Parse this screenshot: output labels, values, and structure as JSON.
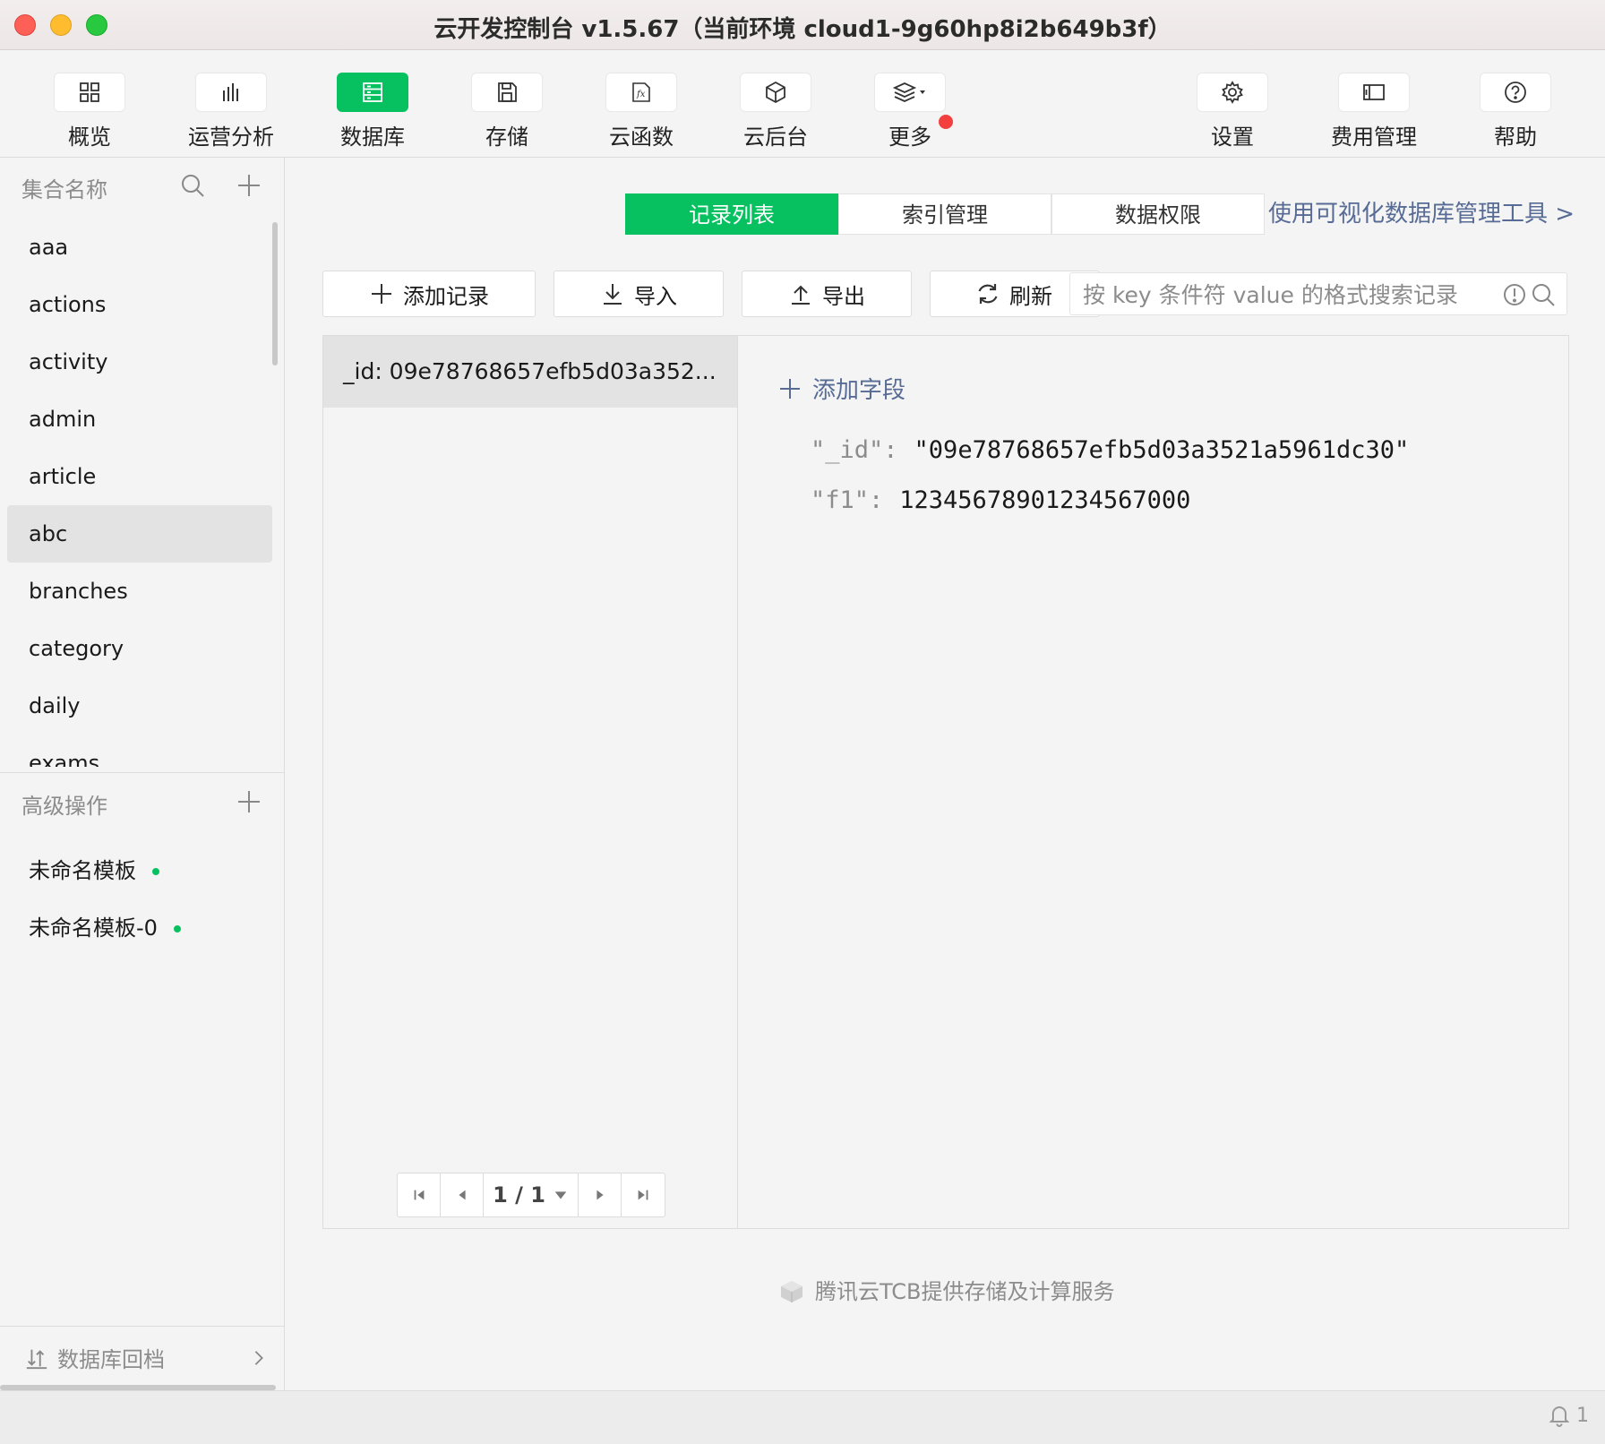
{
  "window": {
    "title": "云开发控制台 v1.5.67（当前环境 cloud1-9g60hp8i2b649b3f）"
  },
  "toolbar": {
    "items": [
      {
        "label": "概览",
        "icon": "grid-icon"
      },
      {
        "label": "运营分析",
        "icon": "bar-chart-icon"
      },
      {
        "label": "数据库",
        "icon": "database-icon"
      },
      {
        "label": "存储",
        "icon": "save-icon"
      },
      {
        "label": "云函数",
        "icon": "function-icon"
      },
      {
        "label": "云后台",
        "icon": "cube-icon"
      },
      {
        "label": "更多",
        "icon": "layers-icon"
      }
    ],
    "right_items": [
      {
        "label": "设置",
        "icon": "gear-icon"
      },
      {
        "label": "费用管理",
        "icon": "wallet-icon"
      },
      {
        "label": "帮助",
        "icon": "help-icon"
      }
    ],
    "active": "数据库"
  },
  "sidebar": {
    "collections_header": "集合名称",
    "collections": [
      "aaa",
      "actions",
      "activity",
      "admin",
      "article",
      "abc",
      "branches",
      "category",
      "daily",
      "exams"
    ],
    "selected": "abc",
    "advanced_header": "高级操作",
    "templates": [
      "未命名模板",
      "未命名模板-0"
    ],
    "backup_label": "数据库回档"
  },
  "tabs": {
    "records": "记录列表",
    "index": "索引管理",
    "permissions": "数据权限"
  },
  "vis_link": "使用可视化数据库管理工具 >",
  "actions": {
    "add_record": "添加记录",
    "import": "导入",
    "export": "导出",
    "refresh": "刷新"
  },
  "search": {
    "placeholder": "按 key 条件符 value 的格式搜索记录"
  },
  "records": {
    "items": [
      "_id: 09e78768657efb5d03a352..."
    ],
    "pager": "1 / 1"
  },
  "detail": {
    "add_field": "添加字段",
    "fields": [
      {
        "key": "\"_id\":",
        "value": "\"09e78768657efb5d03a3521a5961dc30\""
      },
      {
        "key": "\"f1\":",
        "value": "12345678901234567000"
      }
    ]
  },
  "footer": {
    "brand": "腾讯云TCB提供存储及计算服务"
  },
  "status": {
    "notifications": "1"
  },
  "colors": {
    "accent": "#07c160",
    "link": "#576b95",
    "alert": "#f43f3f"
  }
}
